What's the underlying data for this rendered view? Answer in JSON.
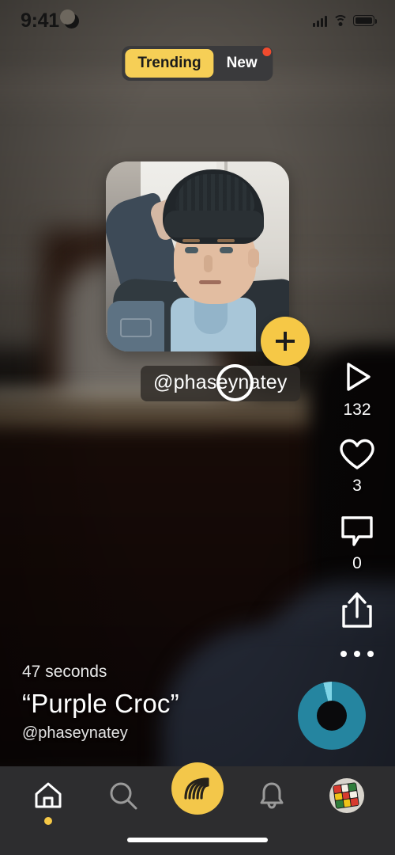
{
  "status_bar": {
    "time": "9:41",
    "dnd_icon": "moon-icon",
    "signal_icon": "cellular-signal-icon",
    "wifi_icon": "wifi-icon",
    "battery_icon": "battery-icon"
  },
  "segmented_control": {
    "options": [
      {
        "label": "Trending",
        "active": true,
        "badge": false
      },
      {
        "label": "New",
        "active": false,
        "badge": true
      }
    ],
    "active_color": "#F6CF56",
    "track_color": "#3A3A3C",
    "badge_color": "#F14B2E"
  },
  "profile_card": {
    "username": "@phaseynatey",
    "follow_button_label": "+",
    "follow_button_color": "#F6C846",
    "follow_icon": "plus-icon"
  },
  "cursor": {
    "name": "circle-cursor"
  },
  "action_rail": [
    {
      "icon": "play-icon",
      "count": "132"
    },
    {
      "icon": "heart-icon",
      "count": "3"
    },
    {
      "icon": "comment-icon",
      "count": "0"
    },
    {
      "icon": "share-icon",
      "count": ""
    },
    {
      "icon": "more-icon",
      "count": ""
    }
  ],
  "video_meta": {
    "duration": "47 seconds",
    "title": "“Purple Croc”",
    "author": "@phaseynatey"
  },
  "progress_ring": {
    "color": "#2585A0",
    "highlight_color": "#7FD4E6",
    "percent": 96
  },
  "tab_bar": {
    "items": [
      {
        "name": "home",
        "icon": "home-icon",
        "active": true
      },
      {
        "name": "search",
        "icon": "search-icon",
        "active": false
      },
      {
        "name": "create",
        "icon": "wave-icon",
        "active": false
      },
      {
        "name": "alerts",
        "icon": "bell-icon",
        "active": false
      },
      {
        "name": "profile",
        "icon": "avatar-icon",
        "active": false
      }
    ],
    "active_dot_color": "#F6C846",
    "background_color": "#2D2D2F"
  }
}
